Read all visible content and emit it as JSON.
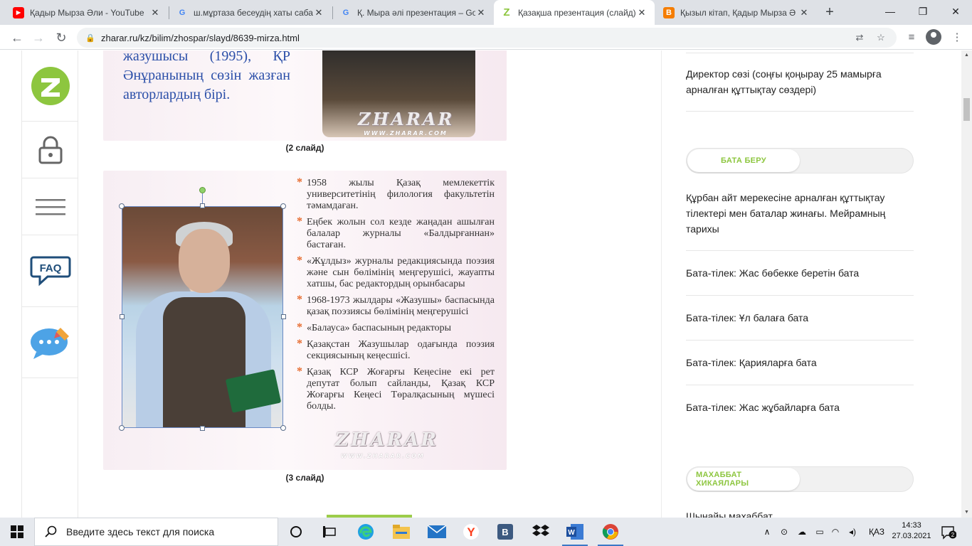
{
  "browser": {
    "tabs": [
      {
        "title": "Қадыр Мырза Әли - YouTube",
        "favicon": "youtube-icon",
        "favicon_color": "#ff0000"
      },
      {
        "title": "ш.мұртаза бесеудің хаты саба",
        "favicon": "google-icon",
        "favicon_color": "#4285f4"
      },
      {
        "title": "Қ. Мыра әлі презентация – Go",
        "favicon": "google-icon",
        "favicon_color": "#4285f4"
      },
      {
        "title": "Қазақша презентация (слайд)",
        "favicon": "zharar-icon",
        "favicon_color": "#8dc63f",
        "active": true
      },
      {
        "title": "Қызыл кітап, Қадыр Мырза Ә",
        "favicon": "blogger-icon",
        "favicon_color": "#f57d00"
      }
    ],
    "url": "zharar.ru/kz/bilim/zhospar/slayd/8639-mirza.html"
  },
  "slides": {
    "slide1_text": "жазушысы (1995), ҚР Әнұранының сөзін жазған авторлардың бірі.",
    "slide1_caption": "(2 слайд)",
    "slide2_caption": "(3 слайд)",
    "watermark": "ZHARAR",
    "watermark_sub": "WWW.ZHARAR.COM",
    "slide2_bullets": [
      "1958 жылы Қазақ мемлекеттік университетінің филология факультетін тәмамдаған.",
      "Еңбек жолын сол кезде жаңадан ашылған балалар журналы «Балдырғаннан» бастаған.",
      "«Жұлдыз» журналы редакциясында поэзия және сын бөлімінің меңгерушісі, жауапты хатшы, бас редактордың орынбасары",
      "1968-1973 жылдары «Жазушы» баспасында қазақ поэзиясы бөлімінің меңгерушісі",
      "«Балауса» баспасының редакторы",
      "Қазақстан Жазушылар одағында поэзия секциясының кеңесшісі.",
      "Қазақ КСР Жоғарғы Кеңесіне екі рет депутат болып сайланды, Қазақ КСР Жоғарғы Кеңесі Төралқасының мүшесі болды."
    ]
  },
  "sidebar": {
    "items": [
      {
        "name": "zharar-logo-icon"
      },
      {
        "name": "lock-icon"
      },
      {
        "name": "menu-icon"
      },
      {
        "name": "faq-icon",
        "label": "FAQ"
      },
      {
        "name": "chat-icon"
      }
    ]
  },
  "right": {
    "link_top": "Директор сөзі (соңғы қоңырау 25 мамырға арналған құттықтау сөздері)",
    "section1": "БАТА БЕРУ",
    "links1": [
      "Құрбан айт мерекесіне арналған құттықтау тілектері мен баталар жинағы. Мейрамның тарихы",
      "Бата-тілек: Жас бөбекке беретін бата",
      "Бата-тілек: Ұл балаға бата",
      "Бата-тілек: Қарияларға бата",
      "Бата-тілек: Жас жұбайларға бата"
    ],
    "section2": "МАХАББАТ ХИКАЯЛАРЫ",
    "link_bottom": "Шынайы махаббат"
  },
  "taskbar": {
    "search_placeholder": "Введите здесь текст для поиска",
    "apps": [
      "cortana-icon",
      "task-view-icon",
      "edge-icon",
      "file-explorer-icon",
      "mail-icon",
      "yandex-icon",
      "vk-icon",
      "dropbox-icon",
      "word-icon",
      "chrome-icon"
    ],
    "lang": "ҚАЗ",
    "time": "14:33",
    "date": "27.03.2021",
    "notifications": "2"
  },
  "colors": {
    "accent_green": "#8dc63f",
    "slide_text_blue": "#2a4ea8",
    "bullet_orange": "#e66b2e"
  }
}
